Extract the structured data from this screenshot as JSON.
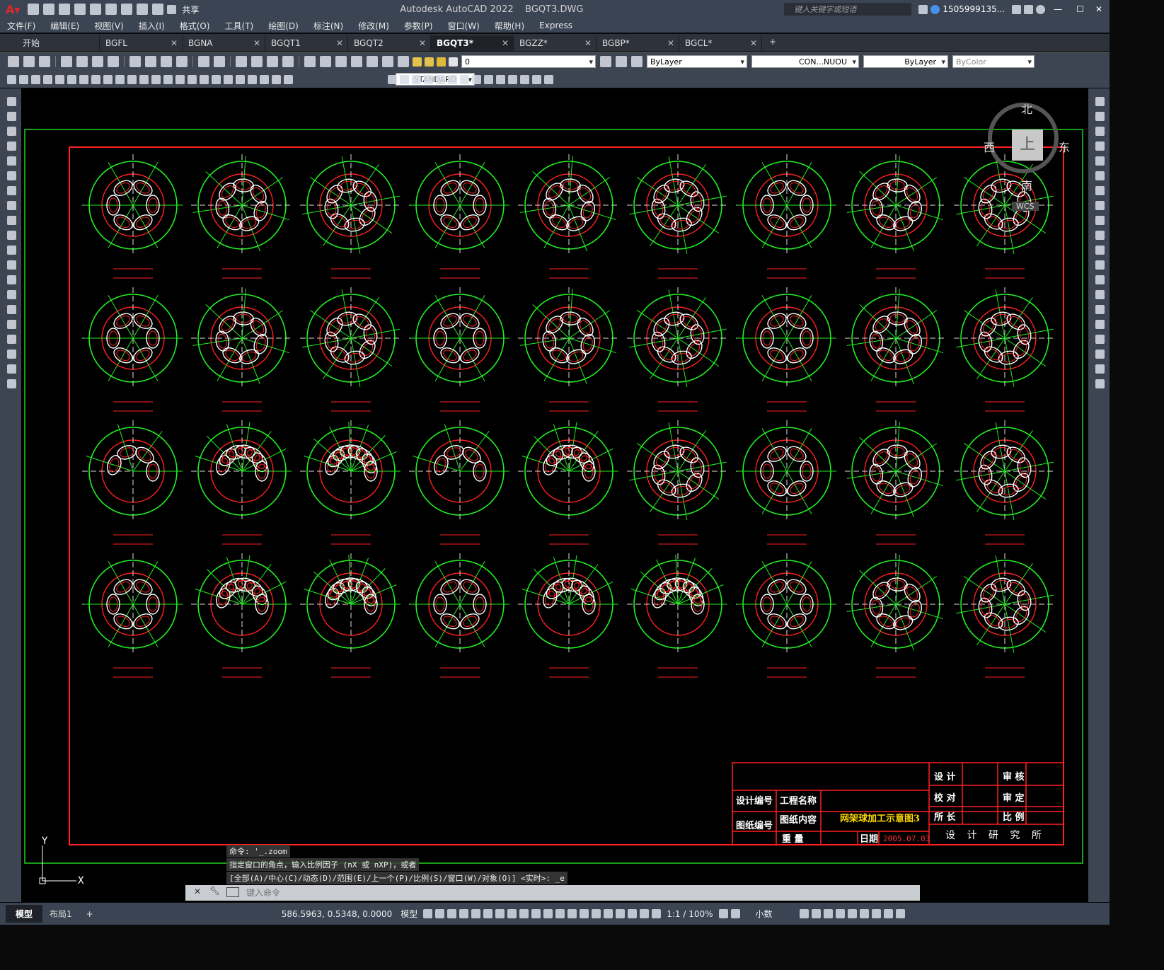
{
  "window": {
    "app_title": "Autodesk AutoCAD 2022",
    "file_title": "BGQT3.DWG",
    "search_placeholder": "键入关键字或短语",
    "user": "1505999135...",
    "share": "共享"
  },
  "menu": [
    "文件(F)",
    "编辑(E)",
    "视图(V)",
    "插入(I)",
    "格式(O)",
    "工具(T)",
    "绘图(D)",
    "标注(N)",
    "修改(M)",
    "参数(P)",
    "窗口(W)",
    "帮助(H)",
    "Express"
  ],
  "tabs": [
    {
      "label": "开始",
      "close": false
    },
    {
      "label": "BGFL",
      "close": true
    },
    {
      "label": "BGNA",
      "close": true
    },
    {
      "label": "BGQT1",
      "close": true
    },
    {
      "label": "BGQT2",
      "close": true
    },
    {
      "label": "BGQT3*",
      "close": true,
      "active": true
    },
    {
      "label": "BGZZ*",
      "close": true
    },
    {
      "label": "BGBP*",
      "close": true
    },
    {
      "label": "BGCL*",
      "close": true
    }
  ],
  "toolbar": {
    "layer": "0",
    "color": "ByLayer",
    "linetype": "CON...NUOU",
    "lineweight": "ByLayer",
    "plotstyle": "ByColor",
    "textstyle": "STANDARD"
  },
  "viewcube": {
    "north": "北",
    "south": "南",
    "east": "东",
    "west": "西",
    "top": "上",
    "wcs": "WCS"
  },
  "title_block": {
    "design": "设 计",
    "review": "审 核",
    "check": "校 对",
    "approve": "审 定",
    "director": "所 长",
    "scale": "比 例",
    "design_no": "设计编号",
    "project_name": "工程名称",
    "drawing_no": "图纸编号",
    "drawing_content": "图纸内容",
    "drawing_title": "网架球加工示意图3",
    "weight": "重  量",
    "date_label": "日期",
    "date": "2005.07.03",
    "institute": "设  计  研  究  所"
  },
  "commands": [
    "命令: '_.zoom",
    "指定窗口的角点，输入比例因子 (nX 或 nXP)，或者",
    "[全部(A)/中心(C)/动态(D)/范围(E)/上一个(P)/比例(S)/窗口(W)/对象(O)] <实时>: _e"
  ],
  "command_placeholder": "键入命令",
  "status": {
    "model_tab": "模型",
    "layout_tab": "布局1",
    "coords": "586.5963, 0.5348, 0.0000",
    "model": "模型",
    "scale": "1:1 / 100%",
    "units": "小数"
  },
  "colors": {
    "frame_red": "#ff2020",
    "outer_green": "#1fd41f",
    "circle_green": "#22ee22",
    "hole_white": "#ffffff",
    "label_red": "#ff3030",
    "title_yellow": "#ffd700"
  },
  "ucs": {
    "y": "Y",
    "x": "X"
  }
}
